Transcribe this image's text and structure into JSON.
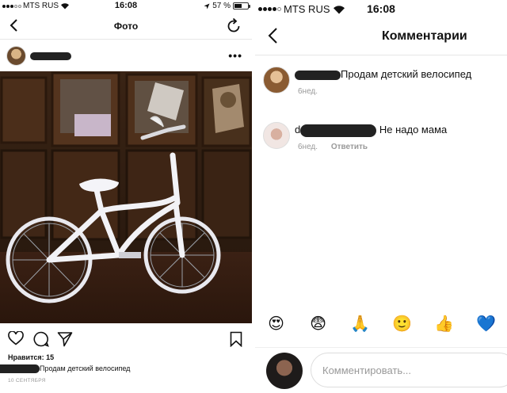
{
  "left": {
    "status": {
      "carrier": "MTS RUS",
      "time": "16:08",
      "battery": "57 %",
      "battery_level": 0.57
    },
    "nav": {
      "title": "Фото"
    },
    "post": {
      "likes": "Нравится: 15",
      "caption": "Продам детский велосипед",
      "date": "10 СЕНТЯБРЯ"
    }
  },
  "right": {
    "status": {
      "carrier": "MTS RUS",
      "time": "16:08"
    },
    "nav": {
      "title": "Комментарии"
    },
    "comments": [
      {
        "username_visible": "",
        "text": "Продам детский велосипед",
        "time": "6нед.",
        "reply": ""
      },
      {
        "username_visible": "d",
        "text": "Не надо мама",
        "time": "6нед.",
        "reply": "Ответить"
      }
    ],
    "emoji_bar": [
      "😍",
      "😨",
      "🙏",
      "🙂",
      "👍",
      "💙"
    ],
    "composer": {
      "placeholder": "Комментировать..."
    }
  },
  "icons": {
    "back": "chevron-left-icon",
    "refresh": "refresh-icon",
    "like": "heart-icon",
    "comment": "comment-icon",
    "share": "send-icon",
    "save": "bookmark-icon",
    "more": "more-icon",
    "wifi": "wifi-icon",
    "location": "location-arrow-icon"
  }
}
